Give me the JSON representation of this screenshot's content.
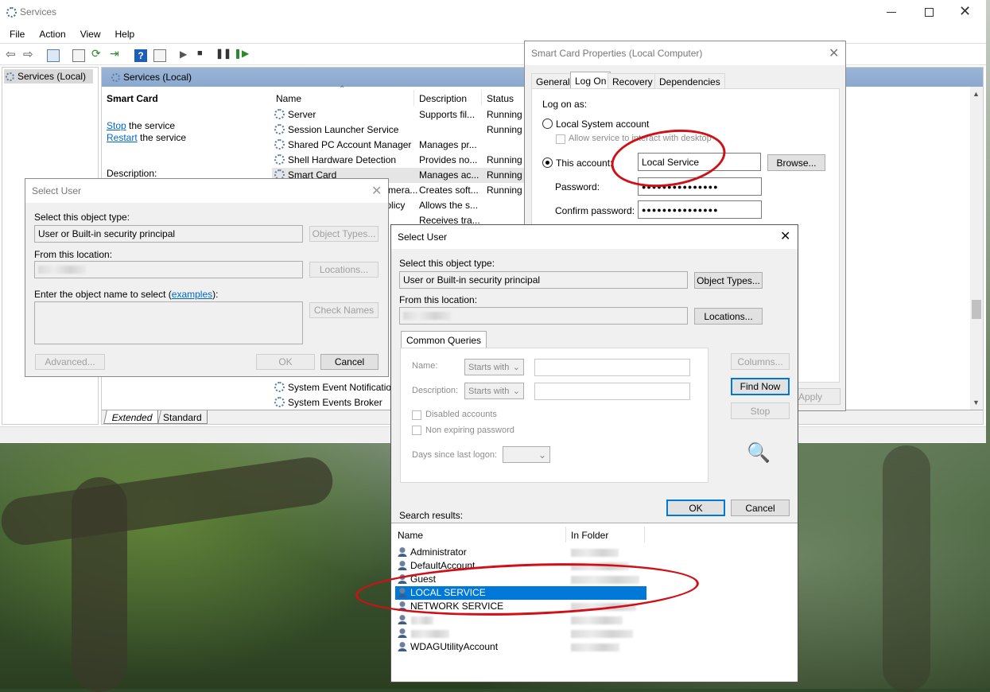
{
  "services_window": {
    "title": "Services",
    "menu": [
      "File",
      "Action",
      "View",
      "Help"
    ],
    "tree_item": "Services (Local)",
    "pane_header": "Services (Local)",
    "selected_service": "Smart Card",
    "stop_link": "Stop",
    "stop_rest": " the service",
    "restart_link": "Restart",
    "restart_rest": " the service",
    "description_label": "Description:",
    "columns": {
      "name": "Name",
      "description": "Description",
      "status": "Status"
    },
    "rows": [
      {
        "name": "Server",
        "description": "Supports fil...",
        "status": "Running"
      },
      {
        "name": "Session Launcher Service",
        "description": "",
        "status": "Running"
      },
      {
        "name": "Shared PC Account Manager",
        "description": "Manages pr...",
        "status": ""
      },
      {
        "name": "Shell Hardware Detection",
        "description": "Provides no...",
        "status": "Running"
      },
      {
        "name": "Smart Card",
        "description": "Manages ac...",
        "status": "Running"
      },
      {
        "name": "Smart Card Device Enumera...",
        "description": "Creates soft...",
        "status": "Running"
      },
      {
        "name": "Smart Card Removal Policy",
        "description": "Allows the s...",
        "status": ""
      },
      {
        "name": "",
        "description": "Receives tra...",
        "status": ""
      }
    ],
    "bottom_rows": [
      "System Event Notificatio",
      "System Events Broker"
    ],
    "tabs": [
      "Extended",
      "Standard"
    ]
  },
  "properties_dialog": {
    "title": "Smart Card Properties (Local Computer)",
    "tabs": [
      "General",
      "Log On",
      "Recovery",
      "Dependencies"
    ],
    "logon_as": "Log on as:",
    "local_system": "Local System account",
    "allow_desktop": "Allow service to interact with desktop",
    "this_account": "This account:",
    "account_value": "Local Service",
    "browse": "Browse...",
    "password": "Password:",
    "confirm_password": "Confirm password:",
    "password_mask": "●●●●●●●●●●●●●●●",
    "apply": "Apply"
  },
  "select_user_back": {
    "title": "Select User",
    "object_type_label": "Select this object type:",
    "object_type_value": "User or Built-in security principal",
    "object_types_btn": "Object Types...",
    "location_label": "From this location:",
    "locations_btn": "Locations...",
    "enter_name": "Enter the object name to select (",
    "examples": "examples",
    "enter_name_end": "):",
    "check_names": "Check Names",
    "advanced": "Advanced...",
    "ok": "OK",
    "cancel": "Cancel"
  },
  "select_user_front": {
    "title": "Select User",
    "object_type_label": "Select this object type:",
    "object_type_value": "User or Built-in security principal",
    "object_types_btn": "Object Types...",
    "location_label": "From this location:",
    "locations_btn": "Locations...",
    "common_queries_tab": "Common Queries",
    "name_label": "Name:",
    "description_label": "Description:",
    "starts_with": "Starts with",
    "columns_btn": "Columns...",
    "find_now_btn": "Find Now",
    "stop_btn": "Stop",
    "disabled_accounts": "Disabled accounts",
    "non_expiring": "Non expiring password",
    "days_since": "Days since last logon:",
    "ok": "OK",
    "cancel": "Cancel",
    "search_results": "Search results:",
    "results_columns": {
      "name": "Name",
      "folder": "In Folder"
    },
    "results": [
      "Administrator",
      "DefaultAccount",
      "Guest",
      "LOCAL SERVICE",
      "NETWORK SERVICE",
      "",
      "",
      "WDAGUtilityAccount"
    ],
    "selected_index": 3
  },
  "colors": {
    "selection": "#0078d7",
    "annotation": "#d10f17",
    "link": "#0066cc"
  }
}
